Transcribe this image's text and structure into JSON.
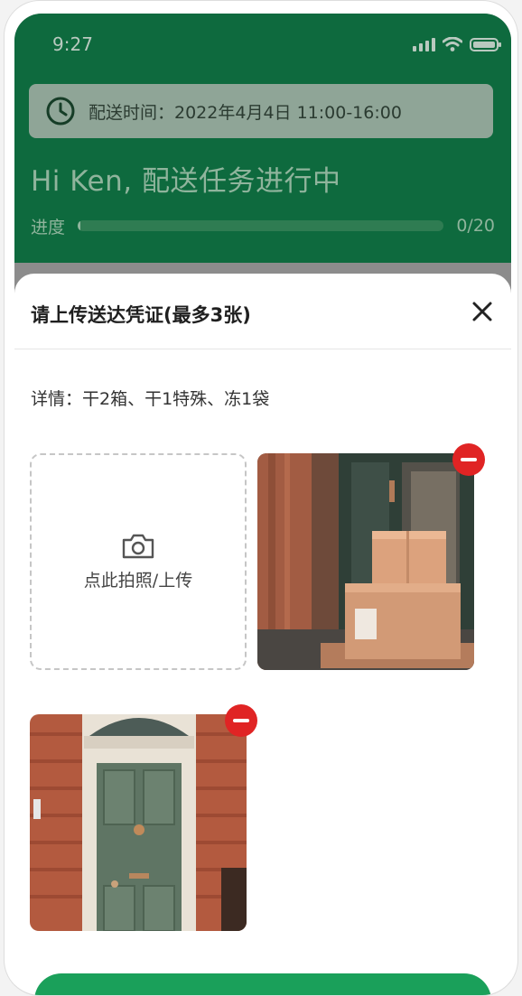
{
  "status_bar": {
    "time": "9:27"
  },
  "header": {
    "delivery_time": "配送时间：2022年4月4日 11:00-16:00",
    "greeting": "Hi Ken, 配送任务进行中",
    "progress_label": "进度",
    "progress_count": "0/20",
    "progress_value": 0
  },
  "sheet": {
    "title": "请上传送达凭证(最多3张)",
    "details": "详情：干2箱、干1特殊、冻1袋",
    "upload_label": "点此拍照/上传",
    "photos": [
      "parcels-at-door-photo",
      "green-front-door-photo"
    ]
  },
  "colors": {
    "brand_green": "#0e6a3e",
    "button_green": "#1aa05a",
    "remove_red": "#e02424"
  },
  "icons": [
    "clock-icon",
    "close-icon",
    "camera-icon",
    "remove-icon",
    "signal-icon",
    "wifi-icon",
    "battery-icon"
  ]
}
